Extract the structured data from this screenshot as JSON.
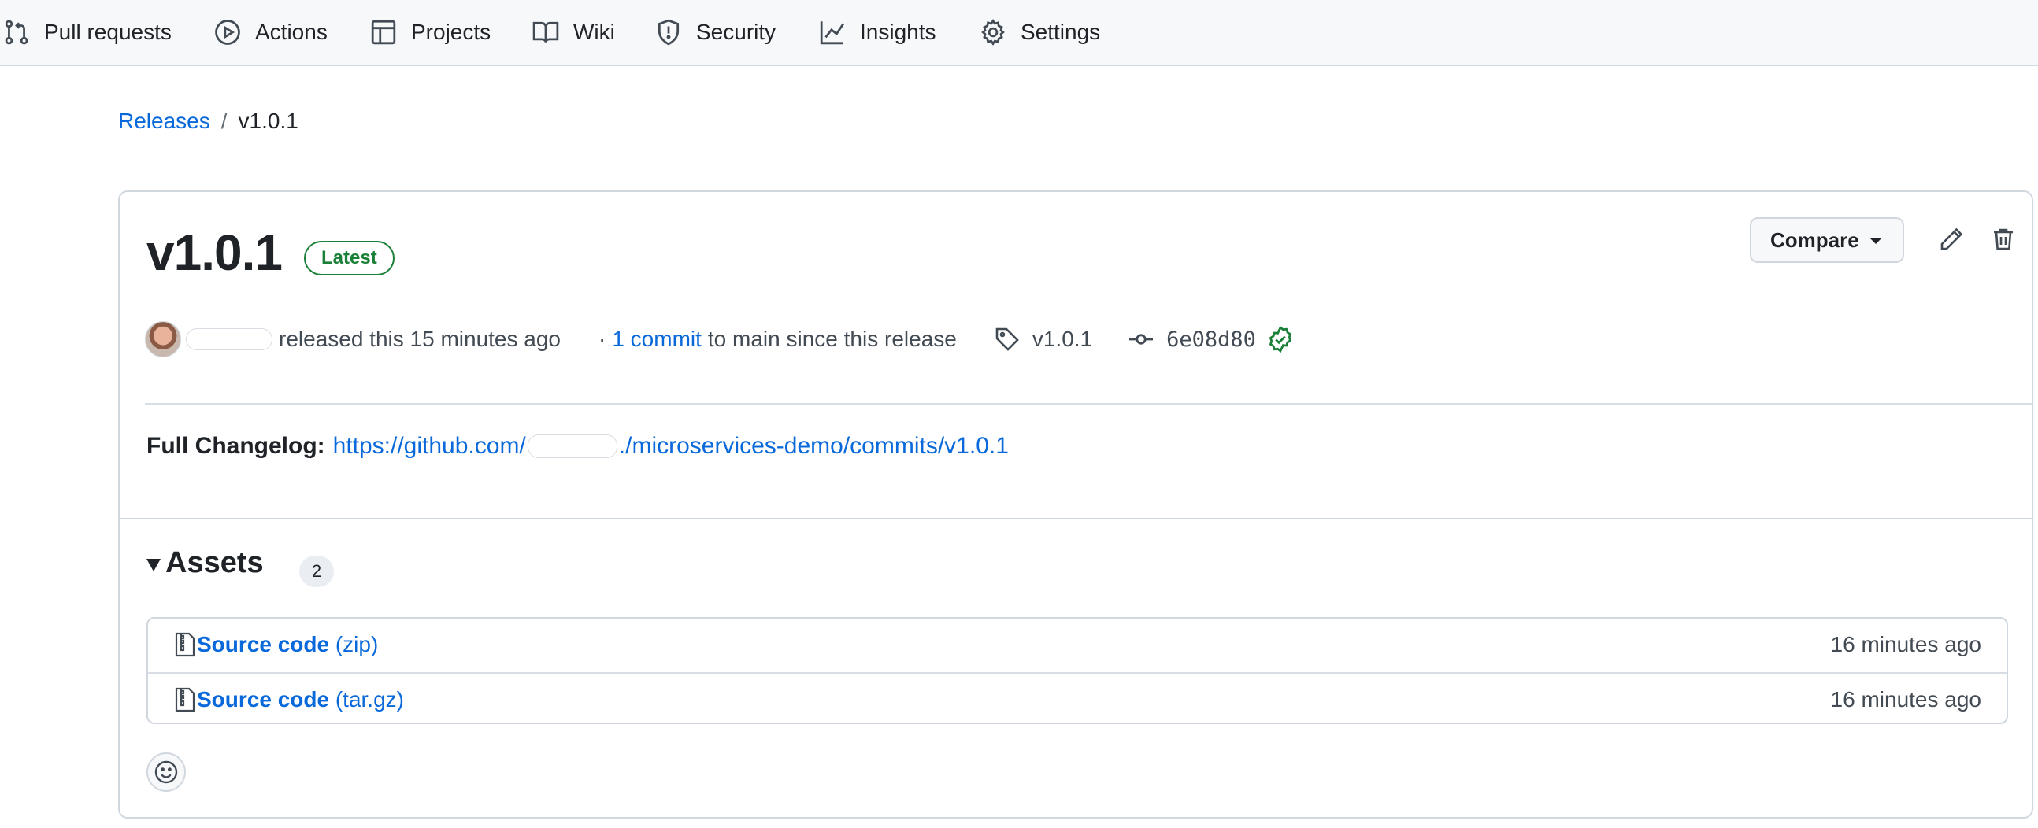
{
  "nav": {
    "items": [
      {
        "label": "Pull requests",
        "icon": "git-pull-request-icon"
      },
      {
        "label": "Actions",
        "icon": "play-circle-icon"
      },
      {
        "label": "Projects",
        "icon": "table-icon"
      },
      {
        "label": "Wiki",
        "icon": "book-icon"
      },
      {
        "label": "Security",
        "icon": "shield-icon"
      },
      {
        "label": "Insights",
        "icon": "graph-icon"
      },
      {
        "label": "Settings",
        "icon": "gear-icon"
      }
    ]
  },
  "breadcrumb": {
    "parent": "Releases",
    "separator": "/",
    "current": "v1.0.1"
  },
  "release": {
    "title": "v1.0.1",
    "badge": "Latest",
    "compare_label": "Compare",
    "released_text": "released this 15 minutes ago",
    "dot": "·",
    "commit_link": "1 commit",
    "commit_suffix": "to main since this release",
    "tag": "v1.0.1",
    "commit_sha": "6e08d80",
    "changelog_label": "Full Changelog:",
    "changelog_url_prefix": "https://github.com/",
    "changelog_url_suffix": "./microservices-demo/commits/v1.0.1"
  },
  "assets": {
    "title": "Assets",
    "count": "2",
    "items": [
      {
        "name": "Source code",
        "ext": "(zip)",
        "time": "16 minutes ago"
      },
      {
        "name": "Source code",
        "ext": "(tar.gz)",
        "time": "16 minutes ago"
      }
    ]
  },
  "colors": {
    "link": "#0969da",
    "success": "#1a7f37",
    "border": "#d0d7de"
  }
}
